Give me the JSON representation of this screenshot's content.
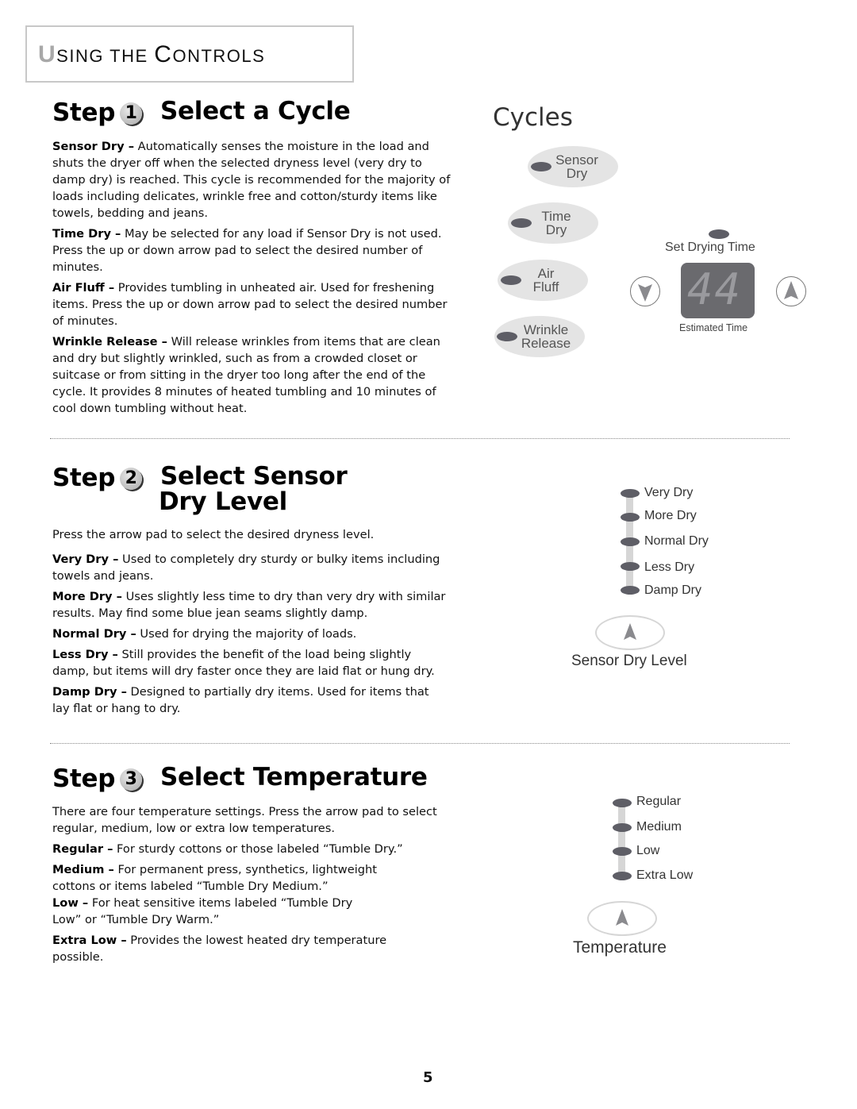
{
  "header": {
    "title_first": "U",
    "title_rest_1": "SING THE ",
    "title_cap_2": "C",
    "title_rest_2": "ONTROLS"
  },
  "steps": [
    {
      "word": "Step",
      "number": "1",
      "title_line1": "Select a Cycle",
      "title_line2": "",
      "intro": "",
      "items": [
        {
          "term": "Sensor Dry –",
          "text": " Automatically senses the moisture in the load and shuts the dryer off when the selected dryness level (very dry to damp dry) is reached. This cycle is recommended for the majority of loads including delicates, wrinkle free and cotton/sturdy items like towels, bedding and jeans."
        },
        {
          "term": "Time Dry –",
          "text": " May be selected for any load if Sensor Dry is not used. Press the up or down arrow pad to select the desired number of minutes."
        },
        {
          "term": "Air Fluff –",
          "text": " Provides tumbling in unheated air. Used for freshening items. Press the up or down arrow pad to select the desired number of minutes."
        },
        {
          "term": "Wrinkle Release –",
          "text": " Will release wrinkles from items that are clean and dry but slightly wrinkled, such as from a crowded closet or suitcase or from sitting in the dryer too long after the end of the cycle. It provides 8 minutes of heated tumbling and 10 minutes of cool down tumbling without heat."
        }
      ]
    },
    {
      "word": "Step",
      "number": "2",
      "title_line1": "Select Sensor",
      "title_line2": "Dry Level",
      "intro": "Press the arrow pad to select the desired dryness level.",
      "items": [
        {
          "term": "Very Dry –",
          "text": " Used to completely dry sturdy or bulky items including towels and jeans."
        },
        {
          "term": "More Dry –",
          "text": " Uses slightly less time to dry than very dry with similar results. May find some blue jean seams slightly damp."
        },
        {
          "term": "Normal Dry –",
          "text": " Used for drying the majority of loads."
        },
        {
          "term": "Less Dry –",
          "text": " Still provides the benefit of the load being slightly damp, but items will dry faster once they are laid flat or hung dry."
        },
        {
          "term": "Damp Dry –",
          "text": " Designed to partially dry items. Used for items that lay flat or hang to dry."
        }
      ]
    },
    {
      "word": "Step",
      "number": "3",
      "title_line1": "Select Temperature",
      "title_line2": "",
      "intro": "There are four temperature settings. Press the arrow pad to select regular, medium, low or extra low temperatures.",
      "items": [
        {
          "term": "Regular –",
          "text": " For sturdy cottons or those labeled “Tumble Dry.”"
        },
        {
          "term": "Medium –",
          "text": " For permanent press, synthetics, lightweight cottons or items labeled “Tumble Dry Medium.”"
        },
        {
          "term": "Low –",
          "text": " For heat sensitive items labeled “Tumble Dry Low” or “Tumble Dry Warm.”"
        },
        {
          "term": "Extra Low –",
          "text": " Provides the lowest heated dry temperature possible."
        }
      ]
    }
  ],
  "cycles_panel": {
    "title": "Cycles",
    "pads": [
      {
        "line1": "Sensor",
        "line2": "Dry"
      },
      {
        "line1": "Time",
        "line2": "Dry"
      },
      {
        "line1": "Air",
        "line2": "Fluff"
      },
      {
        "line1": "Wrinkle",
        "line2": "Release"
      }
    ],
    "set_drying_time_label": "Set Drying Time",
    "display_value": "44",
    "estimated_time_label": "Estimated Time",
    "down_arrow_icon": "down-arrow-icon",
    "up_arrow_icon": "up-arrow-icon"
  },
  "dry_level_panel": {
    "levels": [
      "Very Dry",
      "More Dry",
      "Normal Dry",
      "Less Dry",
      "Damp Dry"
    ],
    "caption": "Sensor Dry Level",
    "button_icon": "up-arrow-icon"
  },
  "temperature_panel": {
    "levels": [
      "Regular",
      "Medium",
      "Low",
      "Extra Low"
    ],
    "caption": "Temperature",
    "button_icon": "up-arrow-icon"
  },
  "page_number": "5",
  "colors": {
    "led": "#5e5e66",
    "pad": "#e4e4e4",
    "display": "#6a6a6e",
    "header_border": "#c8c8c8"
  }
}
